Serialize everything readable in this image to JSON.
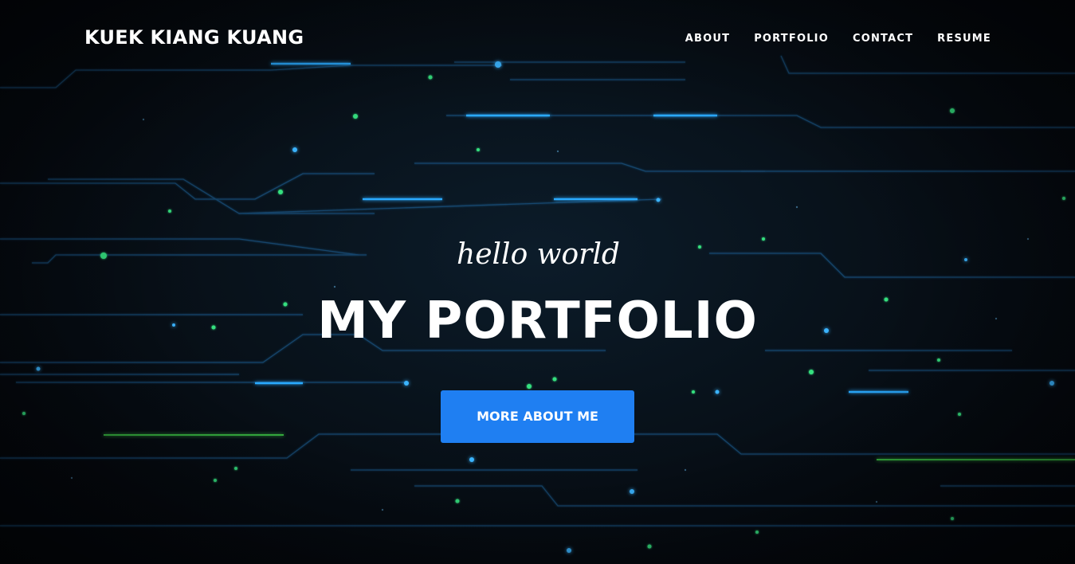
{
  "navbar": {
    "brand": "KUEK KIANG KUANG",
    "links": [
      {
        "label": "ABOUT"
      },
      {
        "label": "PORTFOLIO"
      },
      {
        "label": "CONTACT"
      },
      {
        "label": "RESUME"
      }
    ]
  },
  "hero": {
    "subtitle": "hello world",
    "title": "MY PORTFOLIO",
    "button_label": "MORE ABOUT ME"
  },
  "colors": {
    "background": "#05080d",
    "accent_button": "#1f7ff2",
    "circuit_blue": "#1e9cff",
    "circuit_green": "#2ee07a",
    "text": "#ffffff"
  }
}
